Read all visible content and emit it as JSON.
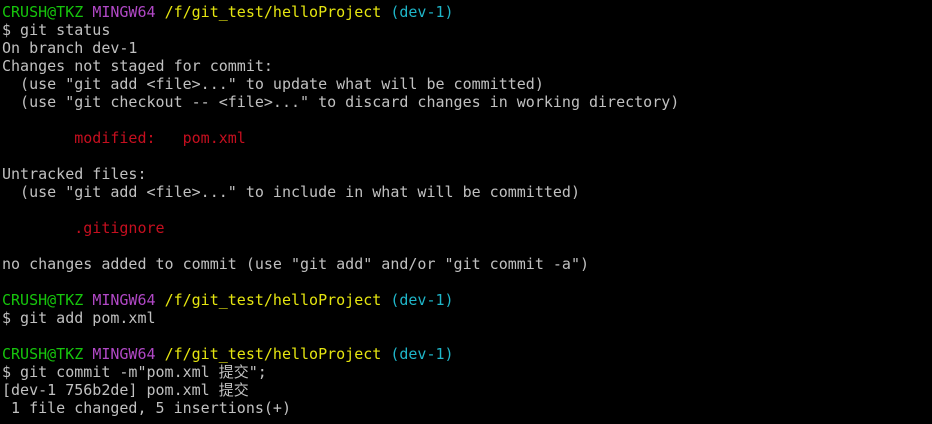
{
  "colors": {
    "background": "#000000",
    "text": "#c0c0c0",
    "user_host": "#16c60c",
    "shell": "#b148c6",
    "path": "#e5e510",
    "branch": "#1fb6c9",
    "git_red": "#c50f1f"
  },
  "prompt": {
    "user_host": "CRUSH@TKZ",
    "shell": "MINGW64",
    "path": "/f/git_test/helloProject",
    "branch": "(dev-1)"
  },
  "lines": {
    "cmd_status": "$ git status",
    "on_branch": "On branch dev-1",
    "not_staged": "Changes not staged for commit:",
    "hint_add": "  (use \"git add <file>...\" to update what will be committed)",
    "hint_checkout": "  (use \"git checkout -- <file>...\" to discard changes in working directory)",
    "modified_label": "        modified:   ",
    "modified_file": "pom.xml",
    "untracked": "Untracked files:",
    "hint_include": "  (use \"git add <file>...\" to include in what will be committed)",
    "untracked_file": "        .gitignore",
    "no_changes": "no changes added to commit (use \"git add\" and/or \"git commit -a\")",
    "cmd_add": "$ git add pom.xml",
    "cmd_commit": "$ git commit -m\"pom.xml 提交\";",
    "commit_result": "[dev-1 756b2de] pom.xml 提交",
    "commit_stats": " 1 file changed, 5 insertions(+)"
  }
}
